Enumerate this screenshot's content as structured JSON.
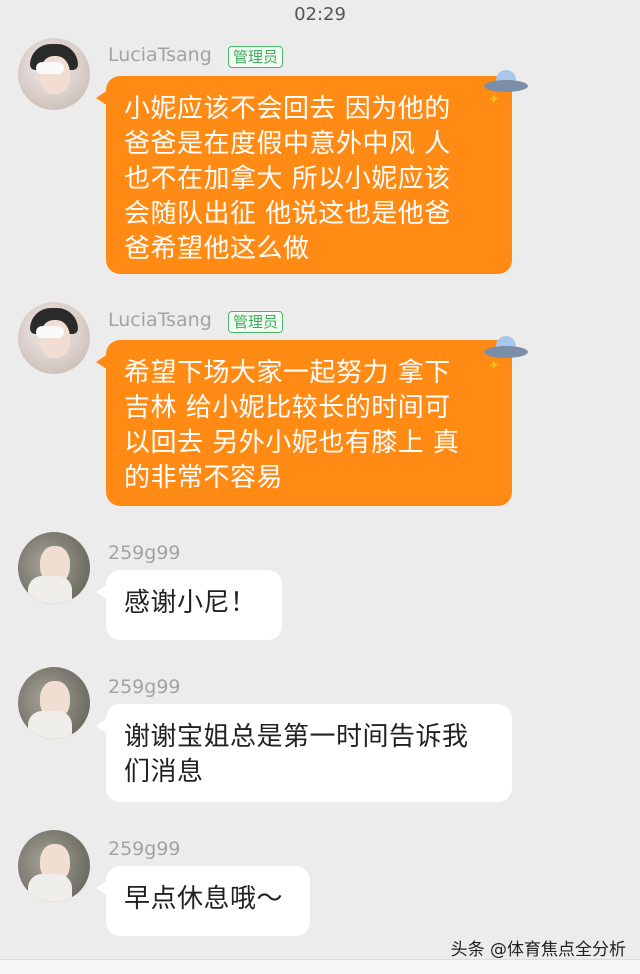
{
  "status": {
    "time": "02:29"
  },
  "messages": [
    {
      "sender": "LuciaTsang",
      "badge": "管理员",
      "text": "小妮应该不会回去 因为他的\n爸爸是在度假中意外中风 人\n也不在加拿大 所以小妮应该\n会随队出征 他说这也是他爸\n爸希望他这么做",
      "style": "orange",
      "sticker": "ufo-sparkle-icon"
    },
    {
      "sender": "LuciaTsang",
      "badge": "管理员",
      "text": "希望下场大家一起努力 拿下\n吉林 给小妮比较长的时间可\n以回去 另外小妮也有膝上 真\n的非常不容易",
      "style": "orange",
      "sticker": "ufo-sparkle-icon"
    },
    {
      "sender": "259g99",
      "text": "感谢小尼！",
      "style": "white"
    },
    {
      "sender": "259g99",
      "text": "谢谢宝姐总是第一时间告诉我\n们消息",
      "style": "white"
    },
    {
      "sender": "259g99",
      "text": "早点休息哦～",
      "style": "white"
    }
  ],
  "watermark": "头条 @体育焦点全分析"
}
